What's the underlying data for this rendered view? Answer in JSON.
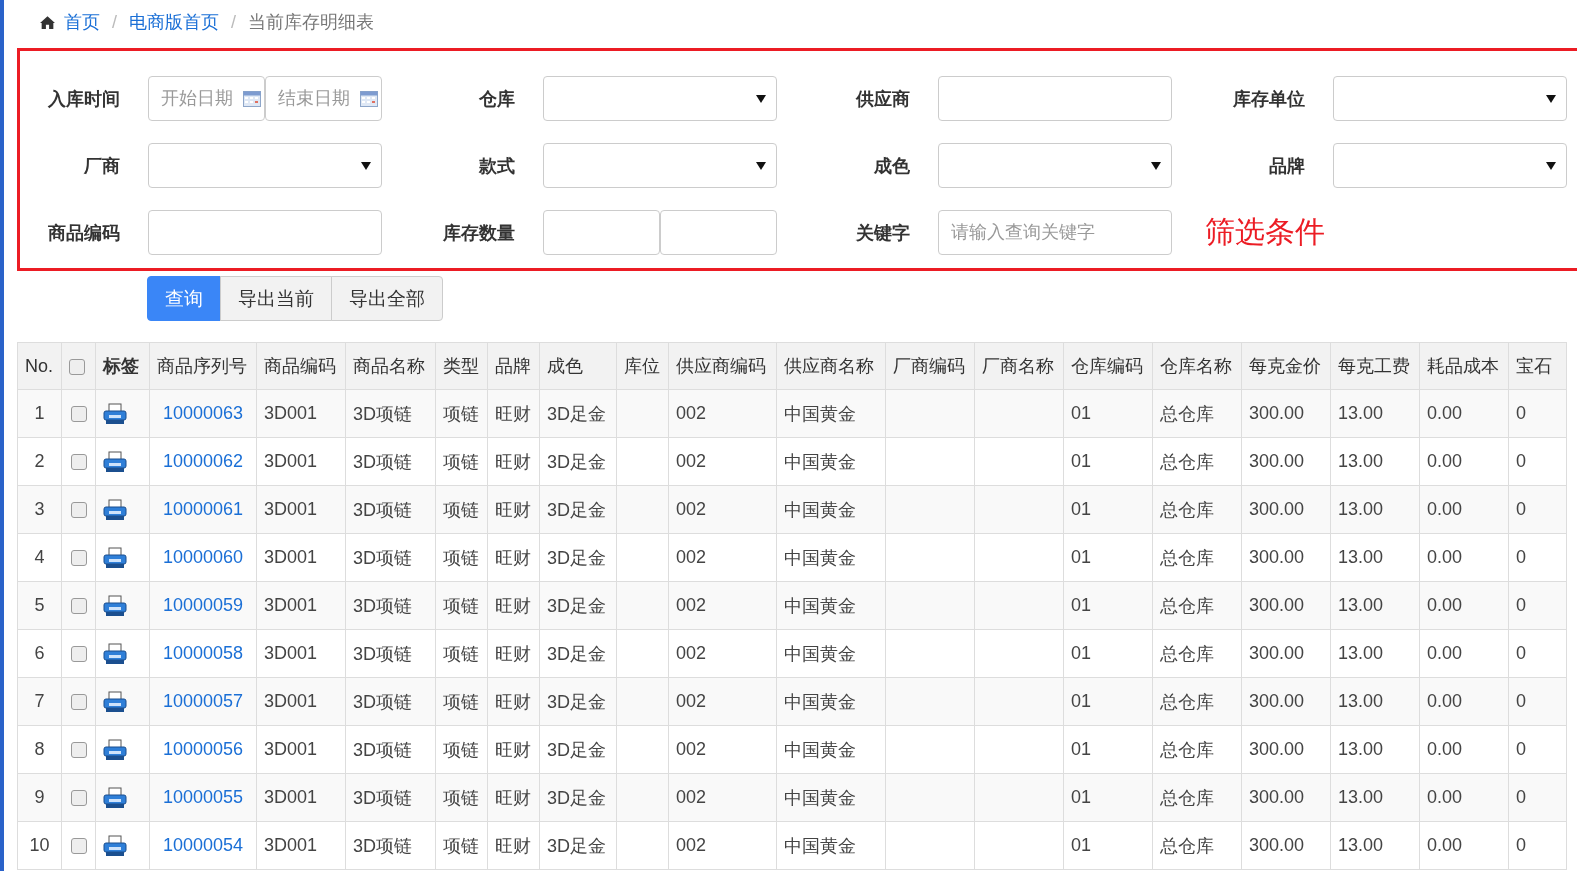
{
  "breadcrumb": [
    {
      "label": "首页",
      "kind": "link"
    },
    {
      "label": "电商版首页",
      "kind": "link",
      "separator": "/"
    },
    {
      "label": "当前库存明细表",
      "kind": "current",
      "separator": "/"
    }
  ],
  "filters": [
    {
      "label": "入库时间",
      "kind": "date_range",
      "placeholders": [
        "开始日期",
        "结束日期"
      ]
    },
    {
      "label": "仓库",
      "kind": "select"
    },
    {
      "label": "供应商",
      "kind": "text"
    },
    {
      "label": "库存单位",
      "kind": "select"
    },
    {
      "label": "厂商",
      "kind": "select"
    },
    {
      "label": "款式",
      "kind": "select"
    },
    {
      "label": "成色",
      "kind": "select"
    },
    {
      "label": "品牌",
      "kind": "select"
    },
    {
      "label": "商品编码",
      "kind": "text"
    },
    {
      "label": "库存数量",
      "kind": "number_range"
    },
    {
      "label": "关键字",
      "kind": "text",
      "placeholder": "请输入查询关键字"
    }
  ],
  "filter_note": "筛选条件",
  "buttons": [
    {
      "label": "查询",
      "primary": true
    },
    {
      "label": "导出当前",
      "primary": false
    },
    {
      "label": "导出全部",
      "primary": false
    }
  ],
  "table": {
    "columns": [
      "No.",
      "标签",
      "商品序列号",
      "商品编码",
      "商品名称",
      "类型",
      "品牌",
      "成色",
      "库位",
      "供应商编码",
      "供应商名称",
      "厂商编码",
      "厂商名称",
      "仓库编码",
      "仓库名称",
      "每克金价",
      "每克工费",
      "耗品成本",
      "宝石"
    ],
    "header_checked": false,
    "rows": [
      {
        "no": "1",
        "checked": false,
        "serial": "10000063",
        "code": "3D001",
        "name": "3D项链",
        "type": "项链",
        "brand": "旺财",
        "grade": "3D足金",
        "supplier_code": "002",
        "supplier_name": "中国黄金",
        "warehouse_code": "01",
        "warehouse_name": "总仓库",
        "gold_price": "300.00",
        "labor": "13.00",
        "consumable": "0.00",
        "gems": "0"
      },
      {
        "no": "2",
        "checked": false,
        "serial": "10000062",
        "code": "3D001",
        "name": "3D项链",
        "type": "项链",
        "brand": "旺财",
        "grade": "3D足金",
        "supplier_code": "002",
        "supplier_name": "中国黄金",
        "warehouse_code": "01",
        "warehouse_name": "总仓库",
        "gold_price": "300.00",
        "labor": "13.00",
        "consumable": "0.00",
        "gems": "0"
      },
      {
        "no": "3",
        "checked": false,
        "serial": "10000061",
        "code": "3D001",
        "name": "3D项链",
        "type": "项链",
        "brand": "旺财",
        "grade": "3D足金",
        "supplier_code": "002",
        "supplier_name": "中国黄金",
        "warehouse_code": "01",
        "warehouse_name": "总仓库",
        "gold_price": "300.00",
        "labor": "13.00",
        "consumable": "0.00",
        "gems": "0"
      },
      {
        "no": "4",
        "checked": false,
        "serial": "10000060",
        "code": "3D001",
        "name": "3D项链",
        "type": "项链",
        "brand": "旺财",
        "grade": "3D足金",
        "supplier_code": "002",
        "supplier_name": "中国黄金",
        "warehouse_code": "01",
        "warehouse_name": "总仓库",
        "gold_price": "300.00",
        "labor": "13.00",
        "consumable": "0.00",
        "gems": "0"
      },
      {
        "no": "5",
        "checked": false,
        "serial": "10000059",
        "code": "3D001",
        "name": "3D项链",
        "type": "项链",
        "brand": "旺财",
        "grade": "3D足金",
        "supplier_code": "002",
        "supplier_name": "中国黄金",
        "warehouse_code": "01",
        "warehouse_name": "总仓库",
        "gold_price": "300.00",
        "labor": "13.00",
        "consumable": "0.00",
        "gems": "0"
      },
      {
        "no": "6",
        "checked": false,
        "serial": "10000058",
        "code": "3D001",
        "name": "3D项链",
        "type": "项链",
        "brand": "旺财",
        "grade": "3D足金",
        "supplier_code": "002",
        "supplier_name": "中国黄金",
        "warehouse_code": "01",
        "warehouse_name": "总仓库",
        "gold_price": "300.00",
        "labor": "13.00",
        "consumable": "0.00",
        "gems": "0"
      },
      {
        "no": "7",
        "checked": false,
        "serial": "10000057",
        "code": "3D001",
        "name": "3D项链",
        "type": "项链",
        "brand": "旺财",
        "grade": "3D足金",
        "supplier_code": "002",
        "supplier_name": "中国黄金",
        "warehouse_code": "01",
        "warehouse_name": "总仓库",
        "gold_price": "300.00",
        "labor": "13.00",
        "consumable": "0.00",
        "gems": "0"
      },
      {
        "no": "8",
        "checked": false,
        "serial": "10000056",
        "code": "3D001",
        "name": "3D项链",
        "type": "项链",
        "brand": "旺财",
        "grade": "3D足金",
        "supplier_code": "002",
        "supplier_name": "中国黄金",
        "warehouse_code": "01",
        "warehouse_name": "总仓库",
        "gold_price": "300.00",
        "labor": "13.00",
        "consumable": "0.00",
        "gems": "0"
      },
      {
        "no": "9",
        "checked": false,
        "serial": "10000055",
        "code": "3D001",
        "name": "3D项链",
        "type": "项链",
        "brand": "旺财",
        "grade": "3D足金",
        "supplier_code": "002",
        "supplier_name": "中国黄金",
        "warehouse_code": "01",
        "warehouse_name": "总仓库",
        "gold_price": "300.00",
        "labor": "13.00",
        "consumable": "0.00",
        "gems": "0"
      },
      {
        "no": "10",
        "checked": false,
        "serial": "10000054",
        "code": "3D001",
        "name": "3D项链",
        "type": "项链",
        "brand": "旺财",
        "grade": "3D足金",
        "supplier_code": "002",
        "supplier_name": "中国黄金",
        "warehouse_code": "01",
        "warehouse_name": "总仓库",
        "gold_price": "300.00",
        "labor": "13.00",
        "consumable": "0.00",
        "gems": "0"
      }
    ]
  }
}
